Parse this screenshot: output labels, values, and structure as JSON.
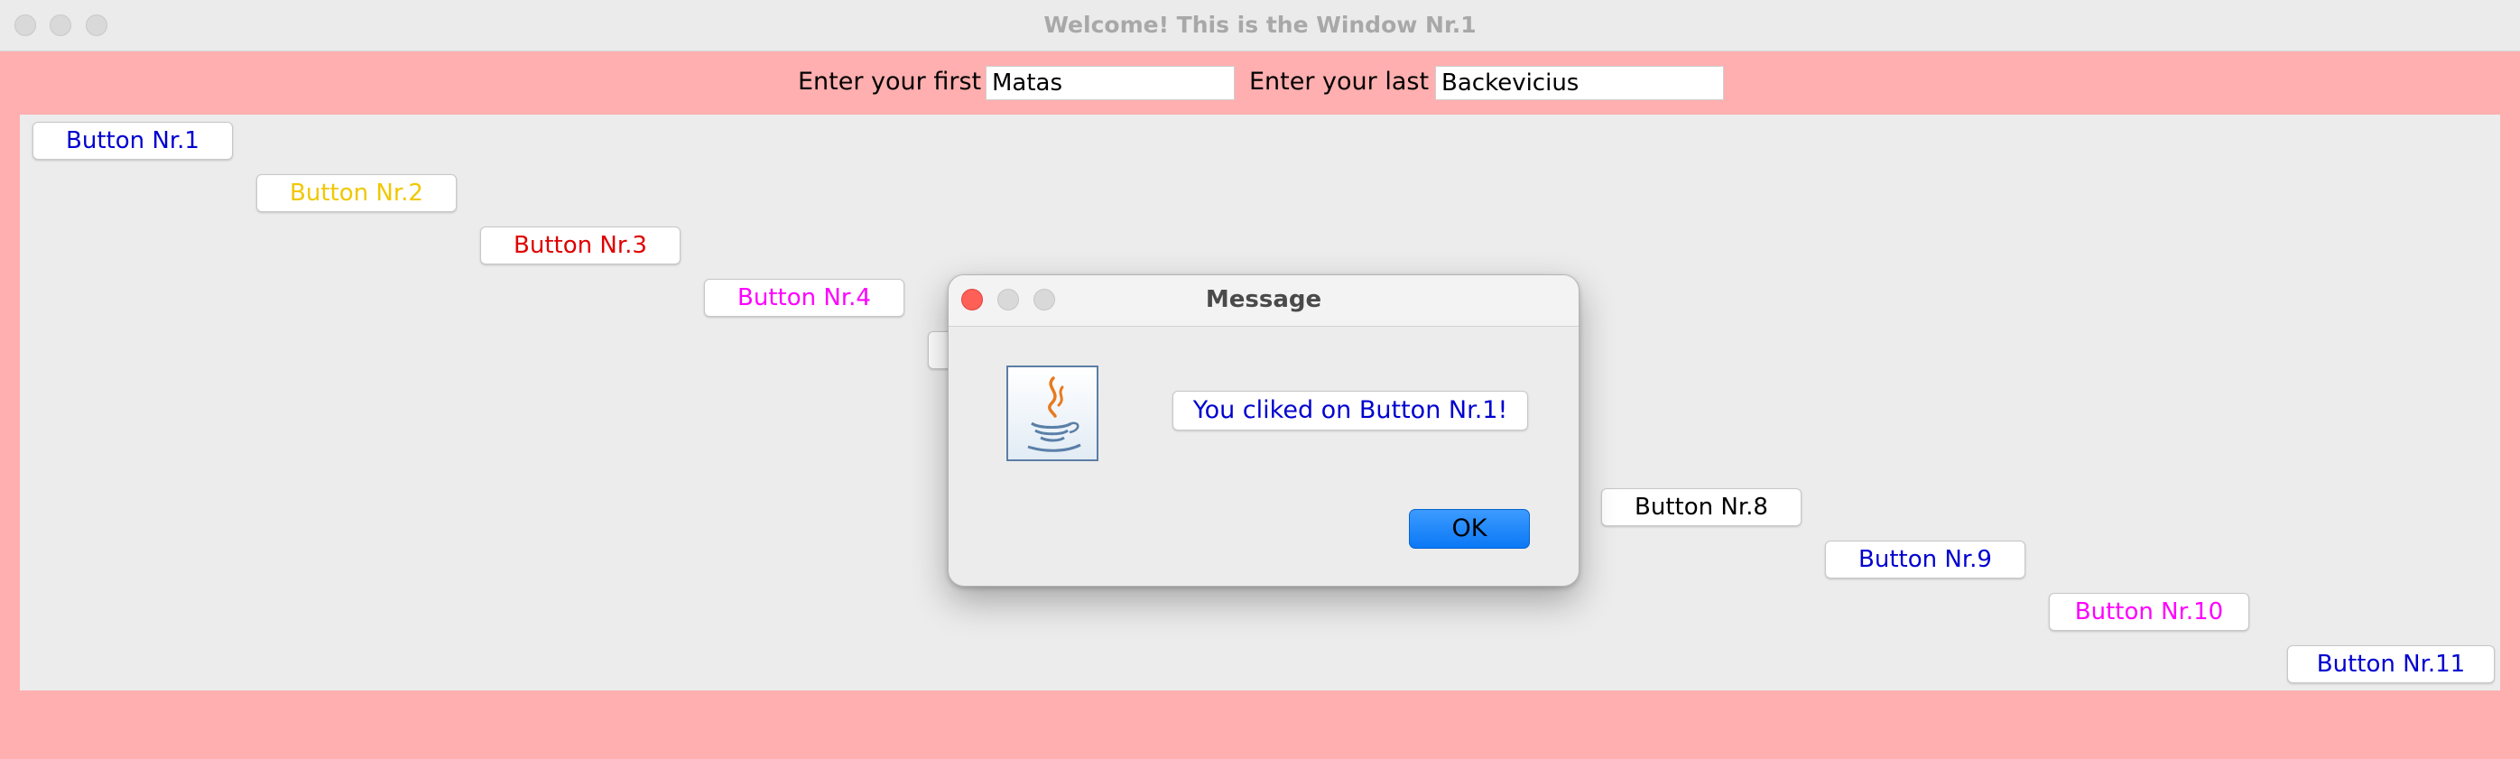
{
  "window": {
    "title": "Welcome! This is the Window Nr.1",
    "background_color": "#ffafaf"
  },
  "form": {
    "first_label": "Enter your first",
    "first_value": "Matas",
    "last_label": "Enter your last",
    "last_value": "Backevicius"
  },
  "buttons": [
    {
      "label": "Button Nr.1",
      "color": "#0000d0"
    },
    {
      "label": "Button Nr.2",
      "color": "#f0c800"
    },
    {
      "label": "Button Nr.3",
      "color": "#e00000"
    },
    {
      "label": "Button Nr.4",
      "color": "#ff00ff"
    },
    {
      "label": "Button Nr.8",
      "color": "#000000"
    },
    {
      "label": "Button Nr.9",
      "color": "#0000d0"
    },
    {
      "label": "Button Nr.10",
      "color": "#ff00ff"
    },
    {
      "label": "Button Nr.11",
      "color": "#0000d0"
    }
  ],
  "dialog": {
    "title": "Message",
    "icon": "java-icon",
    "message": "You cliked on Button Nr.1!",
    "ok_label": "OK"
  }
}
